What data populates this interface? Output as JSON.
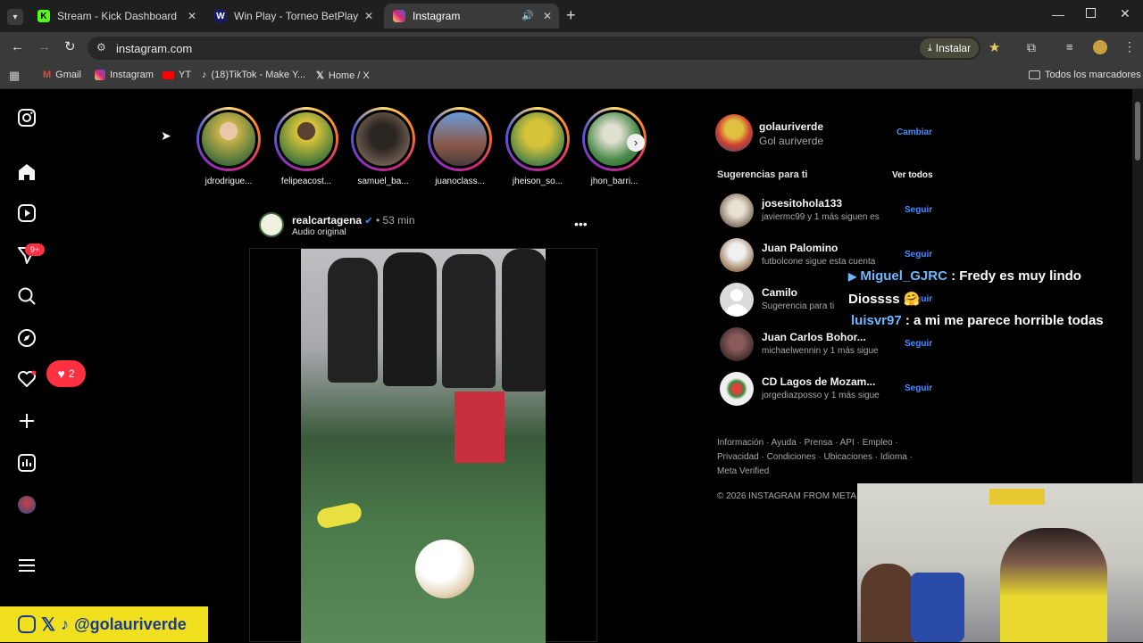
{
  "tabs": [
    {
      "title": "Stream - Kick Dashboard",
      "favicon": "K",
      "color": "#53fc18"
    },
    {
      "title": "Win Play - Torneo BetPlay Dimá",
      "favicon": "W",
      "color": "#1a1a6a"
    },
    {
      "title": "Instagram",
      "favicon": "ig",
      "color": "#d62976"
    }
  ],
  "toolbar": {
    "url": "instagram.com",
    "install_label": "Instalar"
  },
  "bookmarks": [
    {
      "label": "Gmail"
    },
    {
      "label": "Instagram"
    },
    {
      "label": "YT"
    },
    {
      "label": "(18)TikTok - Make Y..."
    },
    {
      "label": "Home / X"
    }
  ],
  "bookmarks_all": "Todos los marcadores",
  "nav": {
    "notifications_badge": "9+",
    "likes_badge": "2"
  },
  "stories": [
    {
      "name": "jdrodrigue...",
      "color": "#c9b34a"
    },
    {
      "name": "felipeacost...",
      "color": "#d8c43a"
    },
    {
      "name": "samuel_ba...",
      "color": "#6b5a4e"
    },
    {
      "name": "juanoclass...",
      "color": "#7a8aa8"
    },
    {
      "name": "jheison_so...",
      "color": "#b9a63a"
    },
    {
      "name": "jhon_barri...",
      "color": "#6a8a5a"
    }
  ],
  "post": {
    "user": "realcartagena",
    "time": "53 min",
    "audio": "Audio original",
    "separator": "•"
  },
  "profile": {
    "username": "golauriverde",
    "fullname": "Gol auriverde",
    "switch_label": "Cambiar"
  },
  "suggestions_title": "Sugerencias para ti",
  "see_all": "Ver todos",
  "suggestions": [
    {
      "name": "josesitohola133",
      "sub": "javiermc99 y 1 más siguen es",
      "follow": "Seguir",
      "color": "#8a7a6a"
    },
    {
      "name": "Juan Palomino",
      "sub": "futbolcone sigue esta cuenta",
      "follow": "Seguir",
      "color": "#a08060"
    },
    {
      "name": "Camilo",
      "sub": "Sugerencia para ti",
      "follow": "Seguir",
      "color": "#c8c8c8"
    },
    {
      "name": "Juan Carlos Bohor...",
      "sub": "michaelwennin y 1 más sigue",
      "follow": "Seguir",
      "color": "#5a3a3a"
    },
    {
      "name": "CD Lagos de Mozam...",
      "sub": "jorgediazposso y 1 más sigue",
      "follow": "Seguir",
      "color": "#f0f0f0"
    }
  ],
  "footer": {
    "line1": "Información · Ayuda · Prensa · API · Empleo ·",
    "line2": "Privacidad · Condiciones · Ubicaciones · Idioma ·",
    "line3": "Meta Verified",
    "copyright": "© 2026 INSTAGRAM FROM META"
  },
  "chat": [
    {
      "user": "Miguel_GJRC",
      "text": ": Fredy es muy lindo",
      "text2": "Diossss 🤗"
    },
    {
      "user": "luisvr97",
      "text": ": a mi me parece horrible todas"
    }
  ],
  "overlay_handle": "@golauriverde"
}
